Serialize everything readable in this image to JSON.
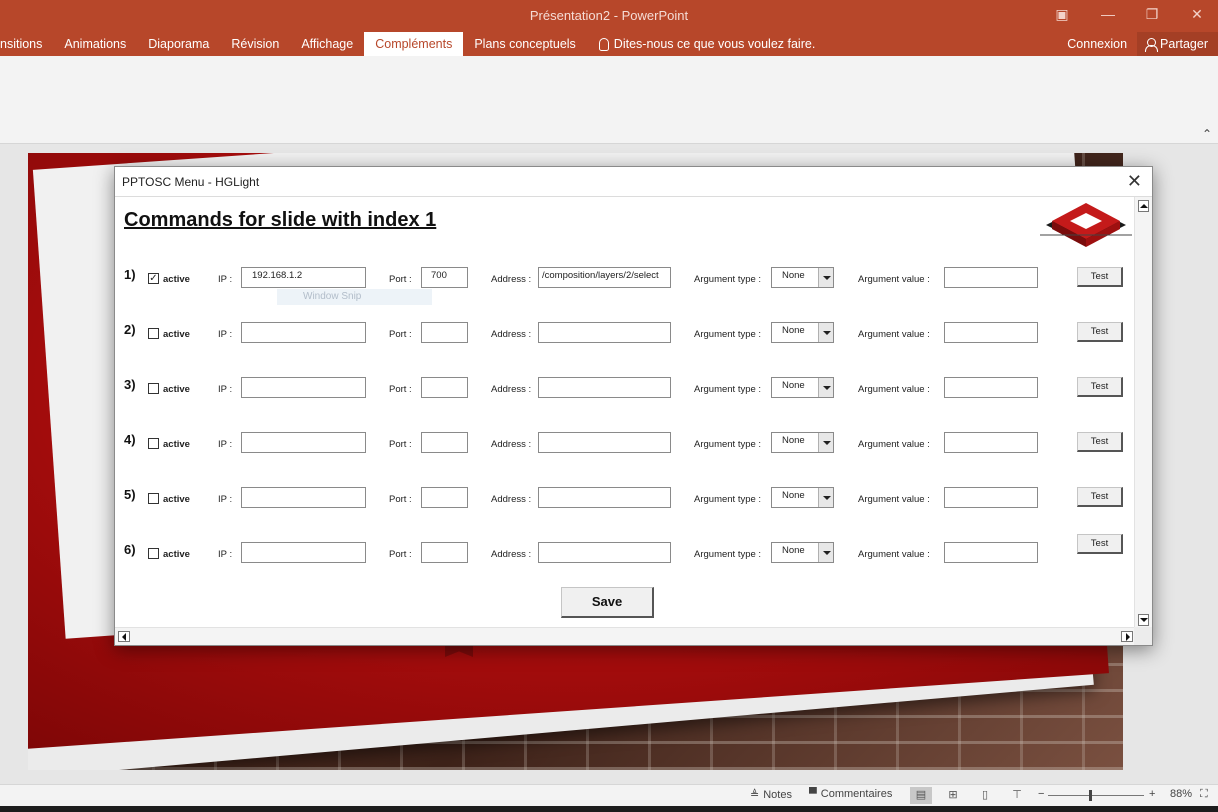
{
  "app": {
    "window_title": "Présentation2 - PowerPoint",
    "tabs": [
      {
        "label": "nsitions"
      },
      {
        "label": "Animations"
      },
      {
        "label": "Diaporama"
      },
      {
        "label": "Révision"
      },
      {
        "label": "Affichage"
      },
      {
        "label": "Compléments",
        "active": true
      },
      {
        "label": "Plans conceptuels"
      }
    ],
    "tell_me": "Dites-nous ce que vous voulez faire.",
    "connexion": "Connexion",
    "share": "Partager"
  },
  "statusbar": {
    "notes": "Notes",
    "comments": "Commentaires",
    "zoom": "88%"
  },
  "dialog": {
    "title": "PPTOSC Menu - HGLight",
    "heading": "Commands for slide with index 1",
    "labels": {
      "active": "active",
      "ip": "IP :",
      "port": "Port :",
      "address": "Address :",
      "arg_type": "Argument type :",
      "arg_value": "Argument value :",
      "test": "Test"
    },
    "rows": [
      {
        "num": "1)",
        "checked": true,
        "ip": "192.168.1.2",
        "port": "700",
        "address": "/composition/layers/2/select",
        "arg_type": "None",
        "arg_value": ""
      },
      {
        "num": "2)",
        "checked": false,
        "ip": "",
        "port": "",
        "address": "",
        "arg_type": "None",
        "arg_value": ""
      },
      {
        "num": "3)",
        "checked": false,
        "ip": "",
        "port": "",
        "address": "",
        "arg_type": "None",
        "arg_value": ""
      },
      {
        "num": "4)",
        "checked": false,
        "ip": "",
        "port": "",
        "address": "",
        "arg_type": "None",
        "arg_value": ""
      },
      {
        "num": "5)",
        "checked": false,
        "ip": "",
        "port": "",
        "address": "",
        "arg_type": "None",
        "arg_value": ""
      },
      {
        "num": "6)",
        "checked": false,
        "ip": "",
        "port": "",
        "address": "",
        "arg_type": "None",
        "arg_value": ""
      }
    ],
    "save": "Save",
    "ghost_tooltip": "Window Snip"
  },
  "colors": {
    "accent": "#b7472a",
    "slide_red": "#c0121b"
  }
}
